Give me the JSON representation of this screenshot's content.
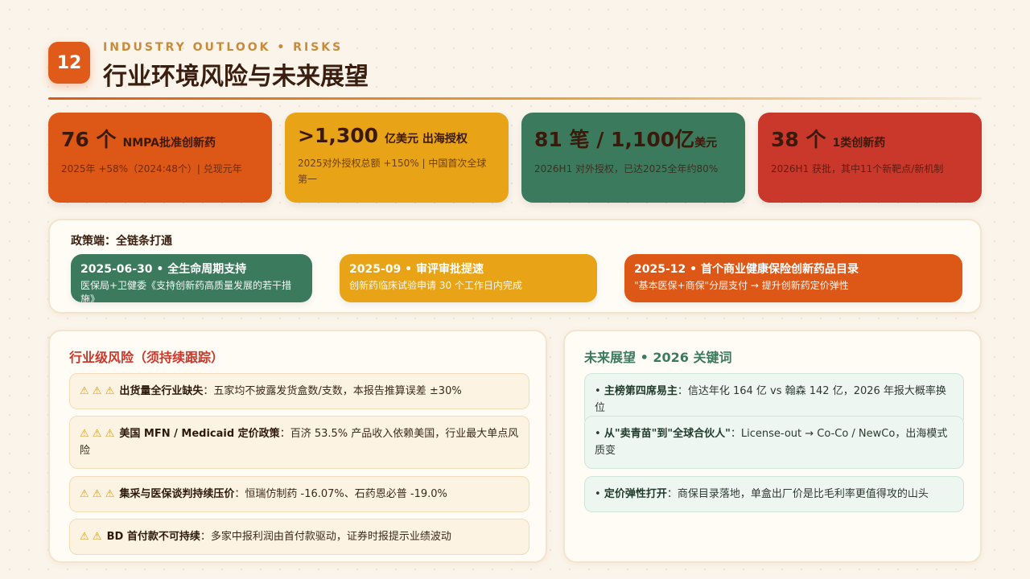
{
  "header": {
    "number": "12",
    "kicker": "INDUSTRY OUTLOOK • RISKS",
    "title": "行业环境风险与未来展望"
  },
  "stats": [
    {
      "big": "76 个",
      "unit": "NMPA批准创新药",
      "sub": "2025年 +58%（2024:48个）| 兑现元年",
      "color": "#dd5716"
    },
    {
      "big": ">1,300",
      "unit": "亿美元 出海授权",
      "sub": "2025对外授权总额 +150% | 中国首次全球第一",
      "color": "#e8a317"
    },
    {
      "big": "81 笔 / 1,100亿",
      "unit": "美元",
      "sub": "2026H1 对外授权，已达2025全年约80%",
      "color": "#3c7a5d"
    },
    {
      "big": "38 个",
      "unit": "1类创新药",
      "sub": "2026H1 获批，其中11个新靶点/新机制",
      "color": "#c9382b"
    }
  ],
  "policy": {
    "title": "政策端：全链条打通",
    "items": [
      {
        "head": "2025-06-30 • 全生命周期支持",
        "body": "医保局+卫健委《支持创新药高质量发展的若干措施》",
        "color": "#3c7a5d"
      },
      {
        "head": "2025-09 • 审评审批提速",
        "body": "创新药临床试验申请 30 个工作日内完成",
        "color": "#e8a317"
      },
      {
        "head": "2025-12 • 首个商业健康保险创新药品目录",
        "body": "\"基本医保+商保\"分层支付 → 提升创新药定价弹性",
        "color": "#dd5716"
      }
    ]
  },
  "risks": {
    "title": "行业级风险（须持续跟踪）",
    "items": [
      {
        "warn": "⚠ ⚠ ⚠",
        "bold": "出货量全行业缺失",
        "text": "：五家均不披露发货盒数/支数，本报告推算误差 ±30%"
      },
      {
        "warn": "⚠ ⚠ ⚠",
        "bold": "美国 MFN / Medicaid 定价政策",
        "text": "：百济 53.5% 产品收入依赖美国，行业最大单点风险"
      },
      {
        "warn": "⚠ ⚠ ⚠",
        "bold": "集采与医保谈判持续压价",
        "text": "：恒瑞仿制药 -16.07%、石药恩必普 -19.0%"
      },
      {
        "warn": "⚠ ⚠",
        "bold": "BD 首付款不可持续",
        "text": "：多家中报利润由首付款驱动，证券时报提示业绩波动"
      }
    ]
  },
  "outlook": {
    "title": "未来展望 • 2026 关键词",
    "items": [
      {
        "bold": "主榜第四席易主",
        "text": "：信达年化 164 亿 vs 翰森 142 亿，2026 年报大概率换位"
      },
      {
        "bold": "从\"卖青苗\"到\"全球合伙人\"",
        "text": "：License-out → Co-Co / NewCo，出海模式质变"
      },
      {
        "bold": "定价弹性打开",
        "text": "：商保目录落地，单盒出厂价是比毛利率更值得攻的山头"
      }
    ]
  }
}
